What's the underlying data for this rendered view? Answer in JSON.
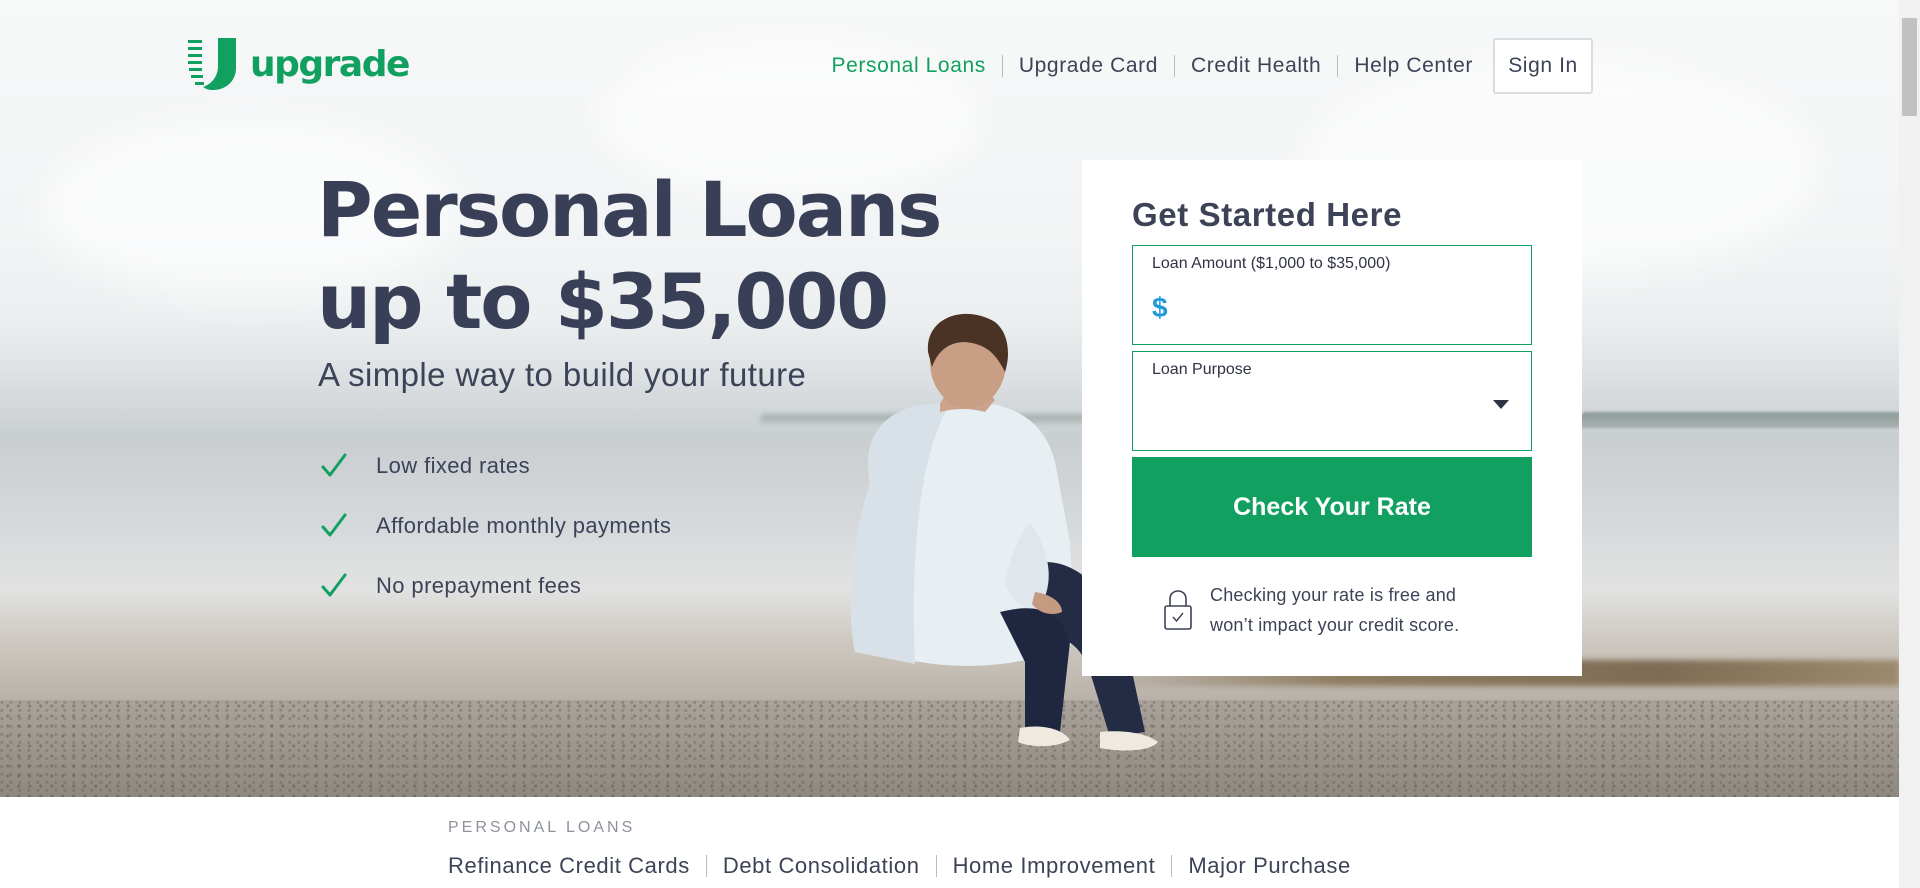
{
  "brand": {
    "name": "upgrade",
    "color": "#12a060"
  },
  "nav": {
    "links": [
      {
        "label": "Personal Loans",
        "active": true
      },
      {
        "label": "Upgrade Card",
        "active": false
      },
      {
        "label": "Credit Health",
        "active": false
      },
      {
        "label": "Help Center",
        "active": false
      }
    ],
    "signin_label": "Sign In"
  },
  "hero": {
    "headline": "Personal Loans up to $35,000",
    "subhead": "A simple way to build your future",
    "features": [
      {
        "text": "Low fixed rates",
        "icon": "checkmark-icon"
      },
      {
        "text": "Affordable monthly payments",
        "icon": "checkmark-icon"
      },
      {
        "text": "No prepayment fees",
        "icon": "checkmark-icon"
      }
    ]
  },
  "form": {
    "title": "Get Started Here",
    "amount": {
      "label": "Loan Amount ($1,000 to $35,000)",
      "prefix": "$",
      "value": ""
    },
    "purpose": {
      "label": "Loan Purpose",
      "value": ""
    },
    "cta_label": "Check Your Rate",
    "note": "Checking your rate is free and won’t impact your credit score.",
    "note_icon": "lock-icon"
  },
  "bottom": {
    "section_label": "PERSONAL LOANS",
    "links": [
      "Refinance Credit Cards",
      "Debt Consolidation",
      "Home Improvement",
      "Major Purchase"
    ]
  }
}
